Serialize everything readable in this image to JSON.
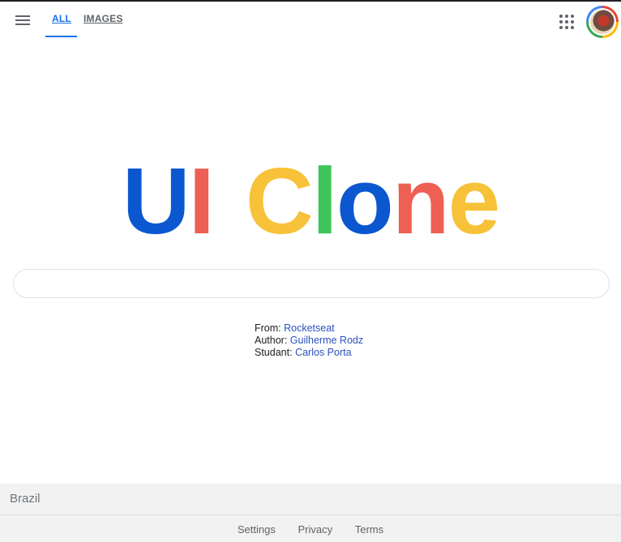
{
  "nav": {
    "tabs": [
      {
        "label": "ALL",
        "active": true
      },
      {
        "label": "IMAGES",
        "active": false
      }
    ],
    "menu_icon": "hamburger-menu-icon",
    "apps_icon": "apps-grid-icon",
    "avatar_icon": "user-avatar"
  },
  "logo": {
    "letters": [
      {
        "char": "U",
        "color": "#0b57d0"
      },
      {
        "char": "I",
        "color": "#ee5f54"
      },
      {
        "char": " ",
        "color": "#ffffff"
      },
      {
        "char": "C",
        "color": "#f7c239"
      },
      {
        "char": "l",
        "color": "#3ec55c"
      },
      {
        "char": "o",
        "color": "#0b57d0"
      },
      {
        "char": "n",
        "color": "#ee5f54"
      },
      {
        "char": "e",
        "color": "#f7c239"
      }
    ]
  },
  "search": {
    "value": "",
    "placeholder": ""
  },
  "credits": {
    "from_label": "From:",
    "from_value": "Rocketseat",
    "author_label": "Author:",
    "author_value": "Guilherme Rodz",
    "student_label": "Studant:",
    "student_value": "Carlos Porta"
  },
  "footer": {
    "country": "Brazil",
    "links": [
      "Settings",
      "Privacy",
      "Terms"
    ]
  }
}
